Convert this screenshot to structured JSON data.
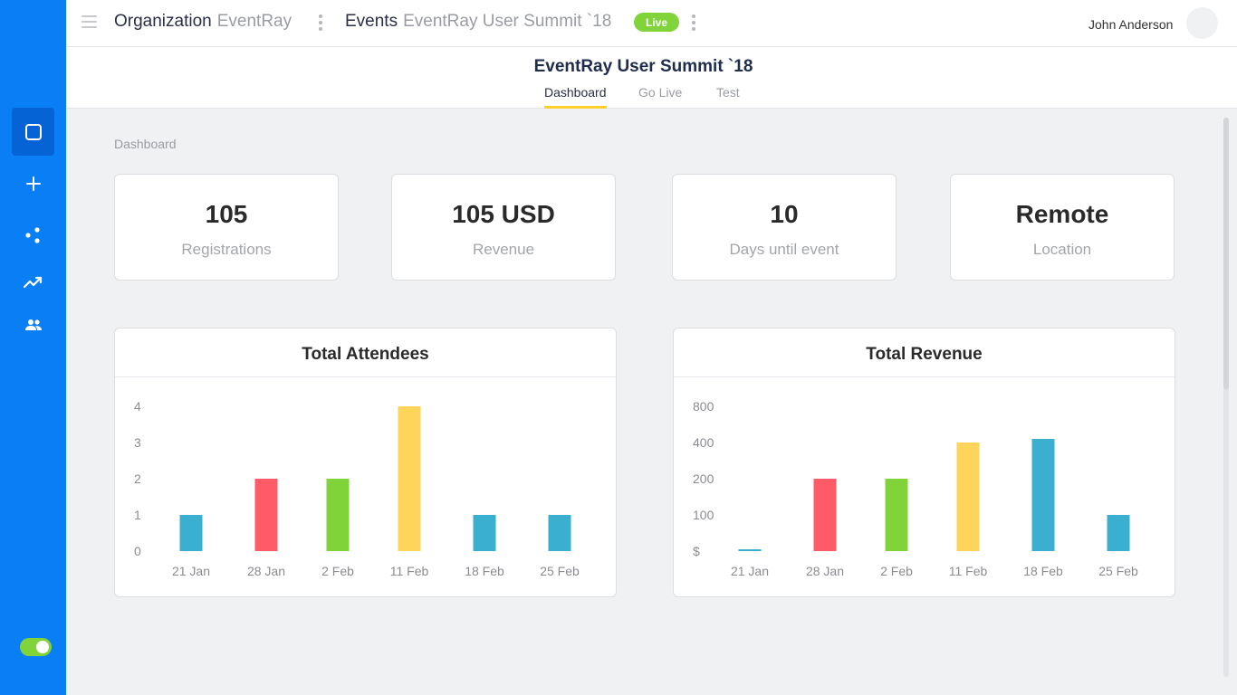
{
  "topbar": {
    "organization_label": "Organization",
    "organization_value": "EventRay",
    "events_label": "Events",
    "event_value": "EventRay User Summit `18",
    "live_badge": "Live",
    "user_name": "John Anderson"
  },
  "event": {
    "title": "EventRay User Summit `18",
    "tabs": [
      {
        "label": "Dashboard",
        "active": true
      },
      {
        "label": "Go Live",
        "active": false
      },
      {
        "label": "Test",
        "active": false
      }
    ]
  },
  "sidebar": {
    "items": [
      {
        "icon": "square-icon",
        "active": true
      },
      {
        "icon": "plus-icon",
        "active": false
      },
      {
        "icon": "nodes-icon",
        "active": false
      },
      {
        "icon": "trend-icon",
        "active": false
      },
      {
        "icon": "people-icon",
        "active": false
      }
    ],
    "toggle_on": true
  },
  "page": {
    "label": "Dashboard"
  },
  "stats": [
    {
      "value": "105",
      "label": "Registrations"
    },
    {
      "value": "105 USD",
      "label": "Revenue"
    },
    {
      "value": "10",
      "label": "Days until event"
    },
    {
      "value": "Remote",
      "label": "Location"
    }
  ],
  "colors": {
    "accent": "#0a7ef5",
    "live": "#80d43a",
    "tab_underline": "#fed02f",
    "bar_blue": "#3aafd0",
    "bar_red": "#ff5a67",
    "bar_green": "#80d43a",
    "bar_yellow": "#fed45a"
  },
  "chart_data": [
    {
      "type": "bar",
      "title": "Total Attendees",
      "categories": [
        "21 Jan",
        "28 Jan",
        "2 Feb",
        "11 Feb",
        "18 Feb",
        "25 Feb"
      ],
      "values": [
        1,
        2,
        2,
        4,
        1,
        1
      ],
      "colors": [
        "#3aafd0",
        "#ff5a67",
        "#80d43a",
        "#fed45a",
        "#3aafd0",
        "#3aafd0"
      ],
      "y_ticks": [
        "0",
        "1",
        "2",
        "3",
        "4"
      ],
      "ylim": [
        0,
        4
      ],
      "grid": false
    },
    {
      "type": "bar",
      "title": "Total Revenue",
      "categories": [
        "21 Jan",
        "28 Jan",
        "2 Feb",
        "11 Feb",
        "18 Feb",
        "25 Feb"
      ],
      "values": [
        5,
        200,
        200,
        400,
        440,
        100
      ],
      "colors": [
        "#3aafd0",
        "#ff5a67",
        "#80d43a",
        "#fed45a",
        "#3aafd0",
        "#3aafd0"
      ],
      "y_ticks": [
        "$",
        "100",
        "200",
        "400",
        "800"
      ],
      "y_tick_values": [
        0,
        100,
        200,
        400,
        800
      ],
      "scale": "piecewise",
      "grid": false
    }
  ]
}
